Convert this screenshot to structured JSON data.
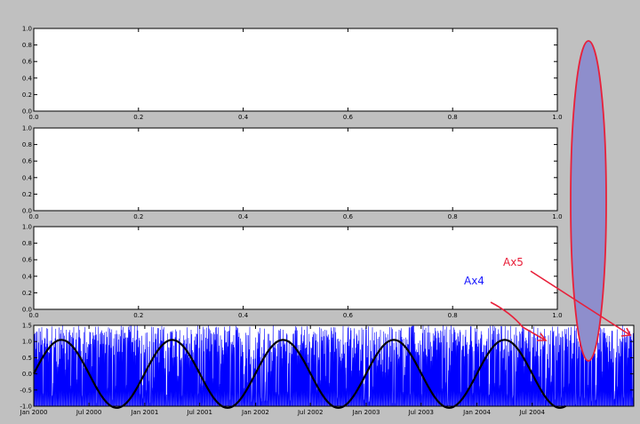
{
  "figure": {
    "background": "#c0c0c0",
    "axes_background": "#ffffff",
    "axes_edge": "#000000"
  },
  "chart_data": [
    {
      "type": "line",
      "panel": 1,
      "xlim": [
        0.0,
        1.0
      ],
      "ylim": [
        0.0,
        1.0
      ],
      "xticks": [
        "0.0",
        "0.2",
        "0.4",
        "0.6",
        "0.8",
        "1.0"
      ],
      "yticks": [
        "0.0",
        "0.2",
        "0.4",
        "0.6",
        "0.8",
        "1.0"
      ],
      "series": []
    },
    {
      "type": "line",
      "panel": 2,
      "xlim": [
        0.0,
        1.0
      ],
      "ylim": [
        0.0,
        1.0
      ],
      "xticks": [
        "0.0",
        "0.2",
        "0.4",
        "0.6",
        "0.8",
        "1.0"
      ],
      "yticks": [
        "0.0",
        "0.2",
        "0.4",
        "0.6",
        "0.8",
        "1.0"
      ],
      "series": []
    },
    {
      "type": "line",
      "panel": 3,
      "xlim": [
        0.0,
        1.0
      ],
      "ylim": [
        0.0,
        1.0
      ],
      "xticks": [
        "0.0",
        "0.2",
        "0.4",
        "0.6",
        "0.8",
        "1.0"
      ],
      "yticks": [
        "0.0",
        "0.2",
        "0.4",
        "0.6",
        "0.8",
        "1.0"
      ],
      "series": []
    },
    {
      "type": "line",
      "panel": 4,
      "xlim": [
        "2000-01-01",
        "2005-06-01"
      ],
      "ylim": [
        -1.0,
        1.5
      ],
      "xticks": [
        {
          "date": "2000-01-01",
          "label": "Jan 2000"
        },
        {
          "date": "2000-07-01",
          "label": "Jul 2000"
        },
        {
          "date": "2001-01-01",
          "label": "Jan 2001"
        },
        {
          "date": "2001-07-01",
          "label": "Jul 2001"
        },
        {
          "date": "2002-01-01",
          "label": "Jan 2002"
        },
        {
          "date": "2002-07-01",
          "label": "Jul 2002"
        },
        {
          "date": "2003-01-01",
          "label": "Jan 2003"
        },
        {
          "date": "2003-07-01",
          "label": "Jul 2003"
        },
        {
          "date": "2004-01-01",
          "label": "Jan 2004"
        },
        {
          "date": "2004-07-01",
          "label": "Jul 2004"
        }
      ],
      "yticks": [
        "-1.0",
        "-0.5",
        "0.0",
        "0.5",
        "1.0",
        "1.5"
      ],
      "series": [
        {
          "style": "noise",
          "color": "#0000ff",
          "x_range": [
            "2000-01-01",
            "2005-06-01"
          ],
          "y_range": [
            -1.0,
            1.5
          ]
        },
        {
          "style": "sine",
          "color": "#000000",
          "x_range": [
            "2000-01-01",
            "2004-10-20"
          ],
          "peaks": [
            "2000-04-01",
            "2001-04-01",
            "2002-04-01",
            "2003-04-01",
            "2004-04-01"
          ],
          "amplitude": 1.05
        }
      ]
    }
  ],
  "annotations": {
    "ax4": {
      "text": "Ax4",
      "color": "#1a1aff"
    },
    "ax5": {
      "text": "Ax5",
      "color": "#e8203a"
    },
    "ellipse": {
      "fill": "#8e8ecc",
      "stroke": "#e8203a"
    }
  }
}
